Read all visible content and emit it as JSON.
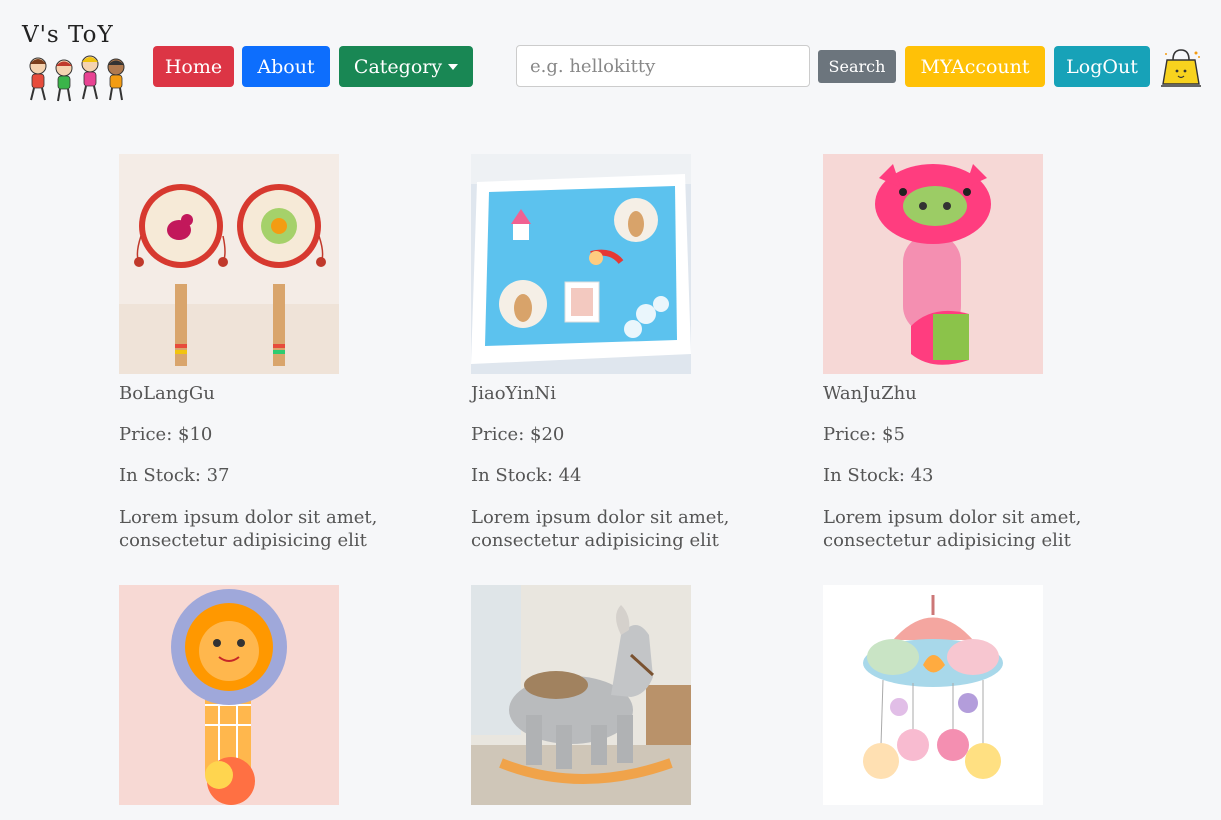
{
  "brand": {
    "title": "V's ToY"
  },
  "nav": {
    "home_label": "Home",
    "about_label": "About",
    "category_label": "Category",
    "search_placeholder": "e.g. hellokitty",
    "search_value": "",
    "search_label": "Search",
    "account_label": "MYAccount",
    "logout_label": "LogOut"
  },
  "colors": {
    "home": "#dc3545",
    "about": "#0d6efd",
    "category": "#198754",
    "search": "#6c757d",
    "account": "#ffc107",
    "logout": "#17a2b8"
  },
  "products": [
    {
      "name": "BoLangGu",
      "price": "Price: $10",
      "stock": "In Stock: 37",
      "desc": "Lorem ipsum dolor sit amet, consectetur adipisicing elit",
      "image": "rattle-drum-image"
    },
    {
      "name": "JiaoYinNi",
      "price": "Price: $20",
      "stock": "In Stock: 44",
      "desc": "Lorem ipsum dolor sit amet, consectetur adipisicing elit",
      "image": "footprint-frame-image"
    },
    {
      "name": "WanJuZhu",
      "price": "Price: $5",
      "stock": "In Stock: 43",
      "desc": "Lorem ipsum dolor sit amet, consectetur adipisicing elit",
      "image": "pig-rattle-image"
    },
    {
      "name": "",
      "price": "",
      "stock": "",
      "desc": "",
      "image": "lion-rattle-image"
    },
    {
      "name": "",
      "price": "",
      "stock": "",
      "desc": "",
      "image": "rocking-horse-image"
    },
    {
      "name": "",
      "price": "",
      "stock": "",
      "desc": "",
      "image": "crib-mobile-image"
    }
  ]
}
